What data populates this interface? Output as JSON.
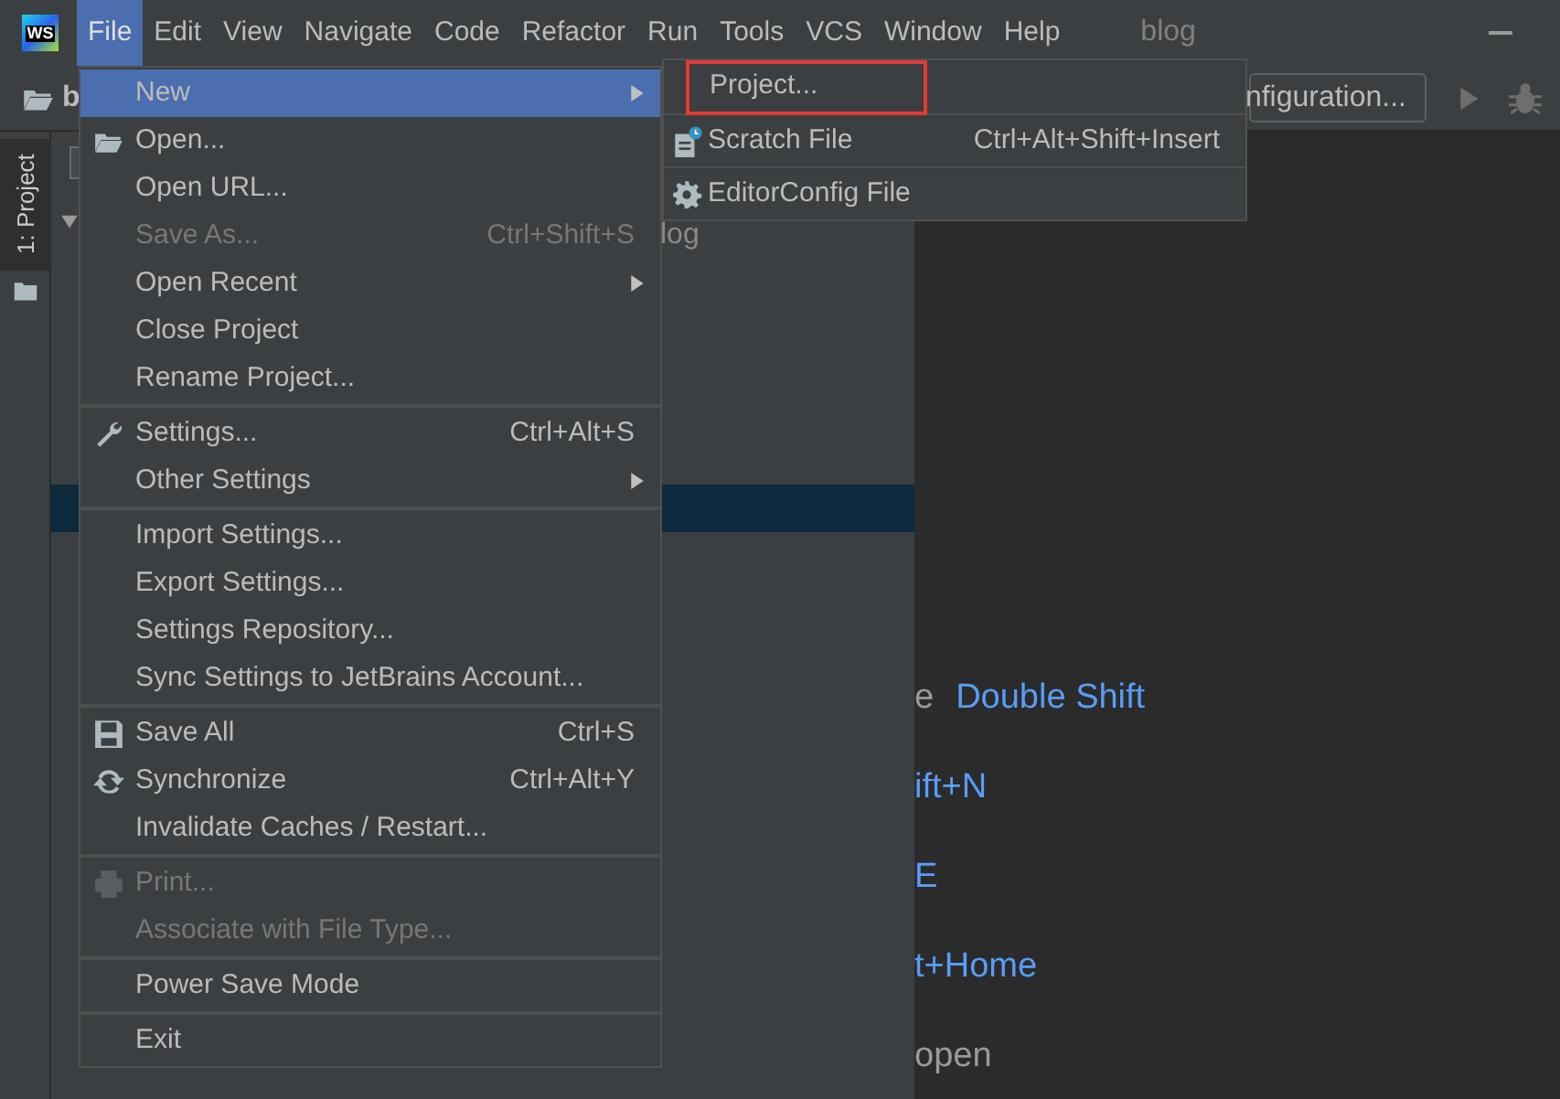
{
  "menu_bar": {
    "items": [
      {
        "label": "File",
        "selected": true
      },
      {
        "label": "Edit",
        "selected": false
      },
      {
        "label": "View",
        "selected": false
      },
      {
        "label": "Navigate",
        "selected": false
      },
      {
        "label": "Code",
        "selected": false
      },
      {
        "label": "Refactor",
        "selected": false
      },
      {
        "label": "Run",
        "selected": false
      },
      {
        "label": "Tools",
        "selected": false
      },
      {
        "label": "VCS",
        "selected": false
      },
      {
        "label": "Window",
        "selected": false
      },
      {
        "label": "Help",
        "selected": false
      }
    ],
    "title": "blog",
    "logo": "WS"
  },
  "toolbar": {
    "breadcrumb": "b",
    "config_button": "nfiguration..."
  },
  "tool_strip": {
    "tabs": [
      {
        "label": "1: Project",
        "selected": true
      }
    ]
  },
  "project_panel": {
    "root_fragment": "log"
  },
  "editor_hints": [
    {
      "text": "e",
      "shortcut": "Double Shift"
    },
    {
      "shortcut": "ift+N"
    },
    {
      "shortcut": "E"
    },
    {
      "shortcut": "t+Home"
    },
    {
      "text": "open"
    }
  ],
  "file_menu": {
    "sections": [
      [
        {
          "label": "New",
          "submenu": true,
          "disabled": false,
          "selected": true,
          "kind": "plain"
        },
        {
          "label": "Open...",
          "submenu": false,
          "disabled": false,
          "selected": false,
          "kind": "folder"
        },
        {
          "label": "Open URL...",
          "submenu": false,
          "disabled": false,
          "selected": false,
          "kind": "plain"
        },
        {
          "label": "Save As...",
          "shortcut": "Ctrl+Shift+S",
          "submenu": false,
          "disabled": true,
          "selected": false,
          "kind": "plain"
        },
        {
          "label": "Open Recent",
          "submenu": true,
          "disabled": false,
          "selected": false,
          "kind": "plain"
        },
        {
          "label": "Close Project",
          "submenu": false,
          "disabled": false,
          "selected": false,
          "kind": "plain"
        },
        {
          "label": "Rename Project...",
          "submenu": false,
          "disabled": false,
          "selected": false,
          "kind": "plain"
        }
      ],
      [
        {
          "label": "Settings...",
          "shortcut": "Ctrl+Alt+S",
          "submenu": false,
          "disabled": false,
          "selected": false,
          "kind": "wrench"
        },
        {
          "label": "Other Settings",
          "submenu": true,
          "disabled": false,
          "selected": false,
          "kind": "plain"
        }
      ],
      [
        {
          "label": "Import Settings...",
          "submenu": false,
          "disabled": false,
          "selected": false,
          "kind": "plain"
        },
        {
          "label": "Export Settings...",
          "submenu": false,
          "disabled": false,
          "selected": false,
          "kind": "plain"
        },
        {
          "label": "Settings Repository...",
          "submenu": false,
          "disabled": false,
          "selected": false,
          "kind": "plain"
        },
        {
          "label": "Sync Settings to JetBrains Account...",
          "submenu": false,
          "disabled": false,
          "selected": false,
          "kind": "plain"
        }
      ],
      [
        {
          "label": "Save All",
          "shortcut": "Ctrl+S",
          "submenu": false,
          "disabled": false,
          "selected": false,
          "kind": "floppy"
        },
        {
          "label": "Synchronize",
          "shortcut": "Ctrl+Alt+Y",
          "submenu": false,
          "disabled": false,
          "selected": false,
          "kind": "sync"
        },
        {
          "label": "Invalidate Caches / Restart...",
          "submenu": false,
          "disabled": false,
          "selected": false,
          "kind": "plain"
        }
      ],
      [
        {
          "label": "Print...",
          "submenu": false,
          "disabled": true,
          "selected": false,
          "kind": "printer"
        },
        {
          "label": "Associate with File Type...",
          "submenu": false,
          "disabled": true,
          "selected": false,
          "kind": "plain"
        }
      ],
      [
        {
          "label": "Power Save Mode",
          "submenu": false,
          "disabled": false,
          "selected": false,
          "kind": "plain"
        }
      ],
      [
        {
          "label": "Exit",
          "submenu": false,
          "disabled": false,
          "selected": false,
          "kind": "plain"
        }
      ]
    ]
  },
  "new_submenu": {
    "items": [
      {
        "label": "Project...",
        "kind": "plain",
        "highlighted": true
      },
      {
        "label": "Scratch File",
        "shortcut": "Ctrl+Alt+Shift+Insert",
        "kind": "scratch",
        "highlighted": false
      },
      {
        "label": "EditorConfig File",
        "kind": "gear",
        "highlighted": false
      }
    ]
  }
}
